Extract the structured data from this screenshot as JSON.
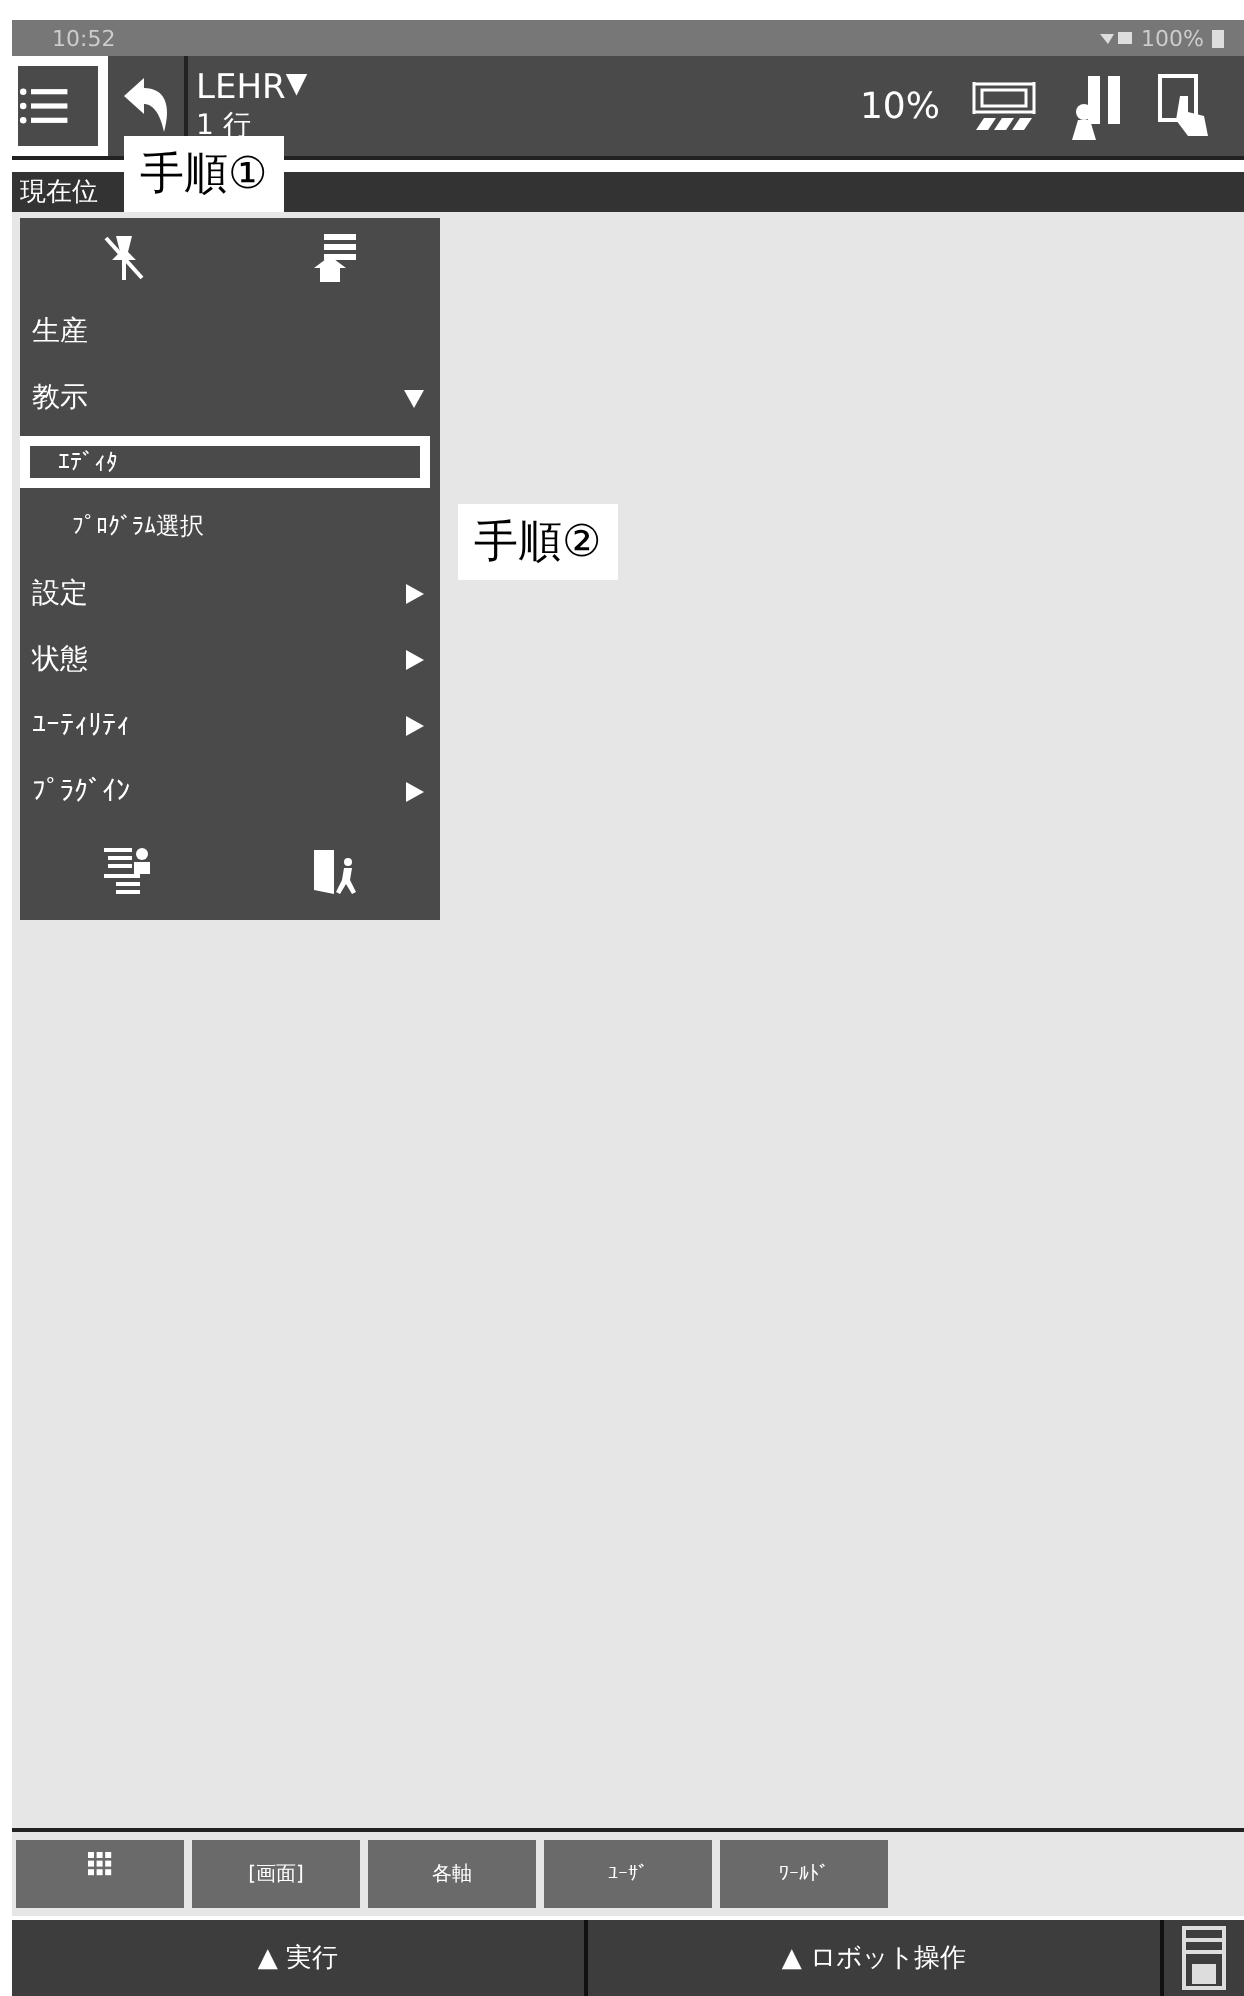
{
  "status_bar": {
    "time": "10:52",
    "battery": "100%"
  },
  "header": {
    "program": "LEHR",
    "program_marker": "▼",
    "line": "1 行",
    "speed": "10%"
  },
  "position_bar": {
    "label": "現在位"
  },
  "callouts": [
    {
      "text": "手順①"
    },
    {
      "text": "手順②"
    }
  ],
  "menu": {
    "items": [
      {
        "label": "生産",
        "kind": "leaf"
      },
      {
        "label": "教示",
        "kind": "group",
        "expanded": true,
        "children": [
          {
            "label": "ｴﾃﾞｨﾀ",
            "selected": true
          },
          {
            "label": "ﾌﾟﾛｸﾞﾗﾑ選択",
            "selected": false
          }
        ]
      },
      {
        "label": "設定",
        "kind": "group",
        "expanded": false
      },
      {
        "label": "状態",
        "kind": "group",
        "expanded": false
      },
      {
        "label": "ﾕｰﾃｨﾘﾃｨ",
        "kind": "group",
        "expanded": false
      },
      {
        "label": "ﾌﾟﾗｸﾞｲﾝ",
        "kind": "group",
        "expanded": false
      }
    ]
  },
  "jog_tabs": [
    {
      "label": "[画面]"
    },
    {
      "label": "各軸"
    },
    {
      "label": "ﾕｰｻﾞ"
    },
    {
      "label": "ﾜｰﾙﾄﾞ"
    }
  ],
  "footer": {
    "buttons": [
      {
        "label": "▲ 実行"
      },
      {
        "label": "▲ ロボット操作"
      }
    ]
  }
}
